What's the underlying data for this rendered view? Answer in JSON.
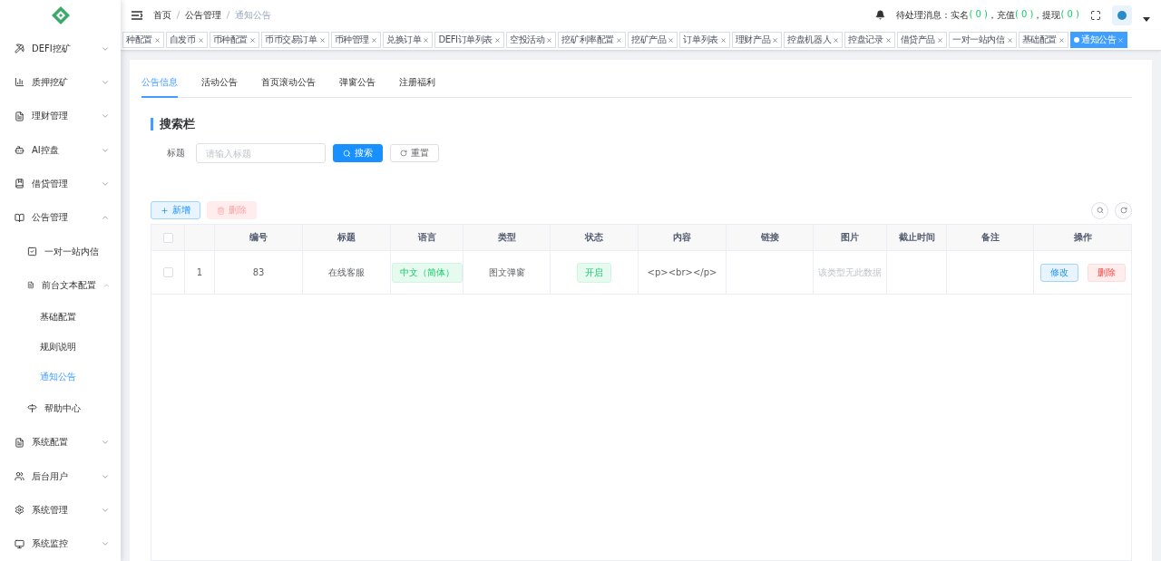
{
  "header": {
    "breadcrumb": [
      "首页",
      "公告管理",
      "通知公告"
    ],
    "pending_label": "待处理消息：",
    "pending": [
      {
        "label": "实名",
        "count": "( 0 )"
      },
      {
        "label": "，充值",
        "count": "( 0 )"
      },
      {
        "label": "，提现",
        "count": "( 0 )"
      }
    ]
  },
  "open_tabs": [
    {
      "label": "种配置",
      "selected": false
    },
    {
      "label": "自发币",
      "selected": false
    },
    {
      "label": "币种配置",
      "selected": false
    },
    {
      "label": "币币交易订单",
      "selected": false
    },
    {
      "label": "币种管理",
      "selected": false
    },
    {
      "label": "兑换订单",
      "selected": false
    },
    {
      "label": "DEFI订单列表",
      "selected": false
    },
    {
      "label": "空投活动",
      "selected": false
    },
    {
      "label": "挖矿利率配置",
      "selected": false
    },
    {
      "label": "挖矿产品",
      "selected": false
    },
    {
      "label": "订单列表",
      "selected": false
    },
    {
      "label": "理财产品",
      "selected": false
    },
    {
      "label": "控盘机器人",
      "selected": false
    },
    {
      "label": "控盘记录",
      "selected": false
    },
    {
      "label": "借贷产品",
      "selected": false
    },
    {
      "label": "一对一站内信",
      "selected": false
    },
    {
      "label": "基础配置",
      "selected": false
    },
    {
      "label": "通知公告",
      "selected": true
    }
  ],
  "sidebar": {
    "items": [
      {
        "label": "DEFI挖矿",
        "expanded": false,
        "selected": false
      },
      {
        "label": "质押挖矿",
        "expanded": false,
        "selected": false
      },
      {
        "label": "理财管理",
        "expanded": false,
        "selected": false
      },
      {
        "label": "AI控盘",
        "expanded": false,
        "selected": false
      },
      {
        "label": "借贷管理",
        "expanded": false,
        "selected": false
      },
      {
        "label": "公告管理",
        "expanded": true,
        "selected": false,
        "children": [
          {
            "label": "一对一站内信",
            "selected": false
          },
          {
            "label": "前台文本配置",
            "expanded": true,
            "selected": false,
            "children": [
              {
                "label": "基础配置",
                "selected": false
              },
              {
                "label": "规则说明",
                "selected": false
              },
              {
                "label": "通知公告",
                "selected": true
              }
            ]
          },
          {
            "label": "帮助中心",
            "selected": false
          }
        ]
      },
      {
        "label": "系统配置",
        "expanded": false,
        "selected": false
      },
      {
        "label": "后台用户",
        "expanded": false,
        "selected": false
      },
      {
        "label": "系统管理",
        "expanded": false,
        "selected": false
      },
      {
        "label": "系统监控",
        "expanded": false,
        "selected": false
      }
    ]
  },
  "page_tabs": [
    {
      "label": "公告信息",
      "selected": true
    },
    {
      "label": "活动公告",
      "selected": false
    },
    {
      "label": "首页滚动公告",
      "selected": false
    },
    {
      "label": "弹窗公告",
      "selected": false
    },
    {
      "label": "注册福利",
      "selected": false
    }
  ],
  "search_section": {
    "title": "搜索栏",
    "field_label": "标题",
    "placeholder": "请输入标题",
    "search_button": "搜索",
    "reset_button": "重置"
  },
  "toolbar": {
    "add_button": "新增",
    "delete_button": "删除",
    "delete_disabled": true
  },
  "table": {
    "select_all_checked": false,
    "columns": [
      "编号",
      "标题",
      "语言",
      "类型",
      "状态",
      "内容",
      "链接",
      "图片",
      "截止时间",
      "备注",
      "操作"
    ],
    "rows": [
      {
        "checked": false,
        "index": "1",
        "id": "83",
        "title": "在线客服",
        "language": "中文（简体）",
        "type": "图文弹窗",
        "status": "开启",
        "content": "<p><br></p>",
        "image": "该类型无此数据",
        "edit": "修改",
        "delete": "删除"
      }
    ]
  }
}
